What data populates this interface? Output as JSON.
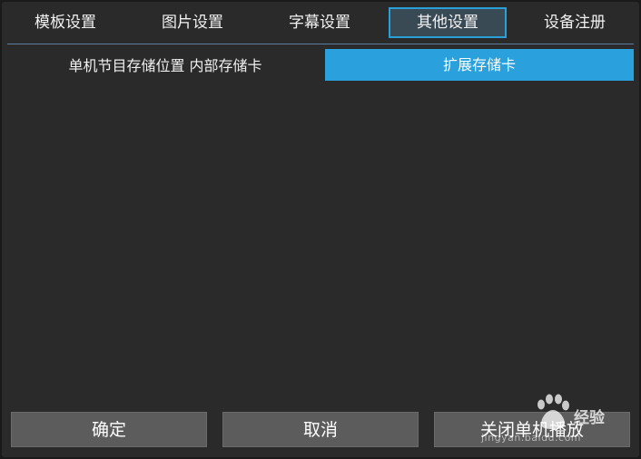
{
  "tabs": [
    {
      "label": "模板设置",
      "active": false
    },
    {
      "label": "图片设置",
      "active": false
    },
    {
      "label": "字幕设置",
      "active": false
    },
    {
      "label": "其他设置",
      "active": true
    },
    {
      "label": "设备注册",
      "active": false
    }
  ],
  "storage": {
    "label": "单机节目存储位置 内部存储卡",
    "selected_option": "扩展存储卡"
  },
  "buttons": {
    "ok": "确定",
    "cancel": "取消",
    "close": "关闭单机播放"
  },
  "watermark": {
    "brand": "经验",
    "url": "jingyan.baidu.com"
  },
  "colors": {
    "accent": "#2aa0dc",
    "panel": "#2a2a2a",
    "button": "#5c5c5c"
  }
}
